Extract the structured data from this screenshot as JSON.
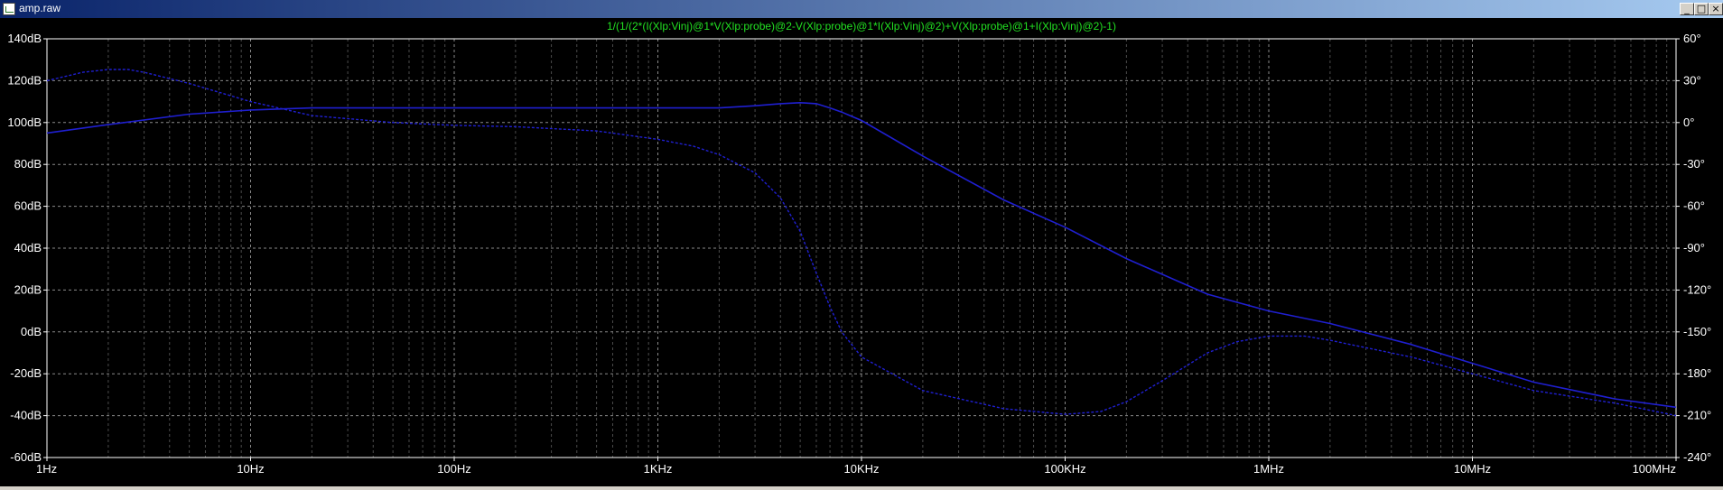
{
  "window": {
    "title": "amp.raw",
    "buttons": {
      "minimize": "_",
      "maximize": "□",
      "close": "×"
    }
  },
  "colors": {
    "background": "#000000",
    "axis_text": "#ffffff",
    "grid": "#8a8a8a",
    "trace": "#1f1fd0",
    "trace_title": "#22e022"
  },
  "chart_data": {
    "type": "line",
    "title": "1/(1/(2*(I(Xlp:Vinj)@1*V(Xlp:probe)@2-V(Xlp:probe)@1*I(Xlp:Vinj)@2)+V(Xlp:probe)@1+I(Xlp:Vinj)@2)-1)",
    "xscale": "log",
    "xlim": [
      1,
      100000000
    ],
    "x_ticks": [
      1,
      10,
      100,
      1000,
      10000,
      100000,
      1000000,
      10000000,
      100000000
    ],
    "x_tick_labels": [
      "1Hz",
      "10Hz",
      "100Hz",
      "1KHz",
      "10KHz",
      "100KHz",
      "1MHz",
      "10MHz",
      "100MHz"
    ],
    "y_left": {
      "lim": [
        -60,
        140
      ],
      "ticks": [
        -60,
        -40,
        -20,
        0,
        20,
        40,
        60,
        80,
        100,
        120,
        140
      ],
      "tick_labels": [
        "-60dB",
        "-40dB",
        "-20dB",
        "0dB",
        "20dB",
        "40dB",
        "60dB",
        "80dB",
        "100dB",
        "120dB",
        "140dB"
      ]
    },
    "y_right": {
      "lim": [
        -240,
        60
      ],
      "ticks": [
        -240,
        -210,
        -180,
        -150,
        -120,
        -90,
        -60,
        -30,
        0,
        30,
        60
      ],
      "tick_labels": [
        "-240°",
        "-210°",
        "-180°",
        "-150°",
        "-120°",
        "-90°",
        "-60°",
        "-30°",
        "0°",
        "30°",
        "60°"
      ]
    },
    "grid": true,
    "series": [
      {
        "kind": "magnitude",
        "axis": "left",
        "style": "solid",
        "x": [
          1,
          2,
          5,
          10,
          20,
          50,
          100,
          200,
          500,
          1000,
          2000,
          3000,
          4000,
          5000,
          6000,
          7000,
          8000,
          10000,
          20000,
          50000,
          100000,
          200000,
          500000,
          1000000,
          2000000,
          5000000,
          10000000,
          20000000,
          50000000,
          100000000
        ],
        "y": [
          95,
          99,
          104,
          106,
          107,
          107,
          107,
          107,
          107,
          107,
          107,
          108,
          109,
          109.5,
          109,
          107,
          105,
          101,
          84,
          63,
          50,
          35,
          18,
          10,
          4,
          -6,
          -15,
          -24,
          -32,
          -36
        ]
      },
      {
        "kind": "phase",
        "axis": "right",
        "style": "dashed",
        "x": [
          1,
          1.5,
          2,
          2.5,
          3,
          5,
          10,
          20,
          50,
          100,
          200,
          500,
          1000,
          1500,
          2000,
          3000,
          4000,
          5000,
          6000,
          7000,
          8000,
          10000,
          20000,
          50000,
          100000,
          150000,
          200000,
          300000,
          500000,
          700000,
          1000000,
          1500000,
          2000000,
          5000000,
          10000000,
          20000000,
          50000000,
          100000000
        ],
        "y": [
          30,
          36,
          38,
          38,
          36,
          28,
          15,
          5,
          0,
          -2,
          -3,
          -6,
          -12,
          -17,
          -23,
          -36,
          -54,
          -78,
          -108,
          -132,
          -150,
          -168,
          -192,
          -205,
          -209,
          -207,
          -200,
          -185,
          -165,
          -157,
          -153,
          -153,
          -156,
          -168,
          -180,
          -192,
          -201,
          -210
        ]
      }
    ]
  }
}
